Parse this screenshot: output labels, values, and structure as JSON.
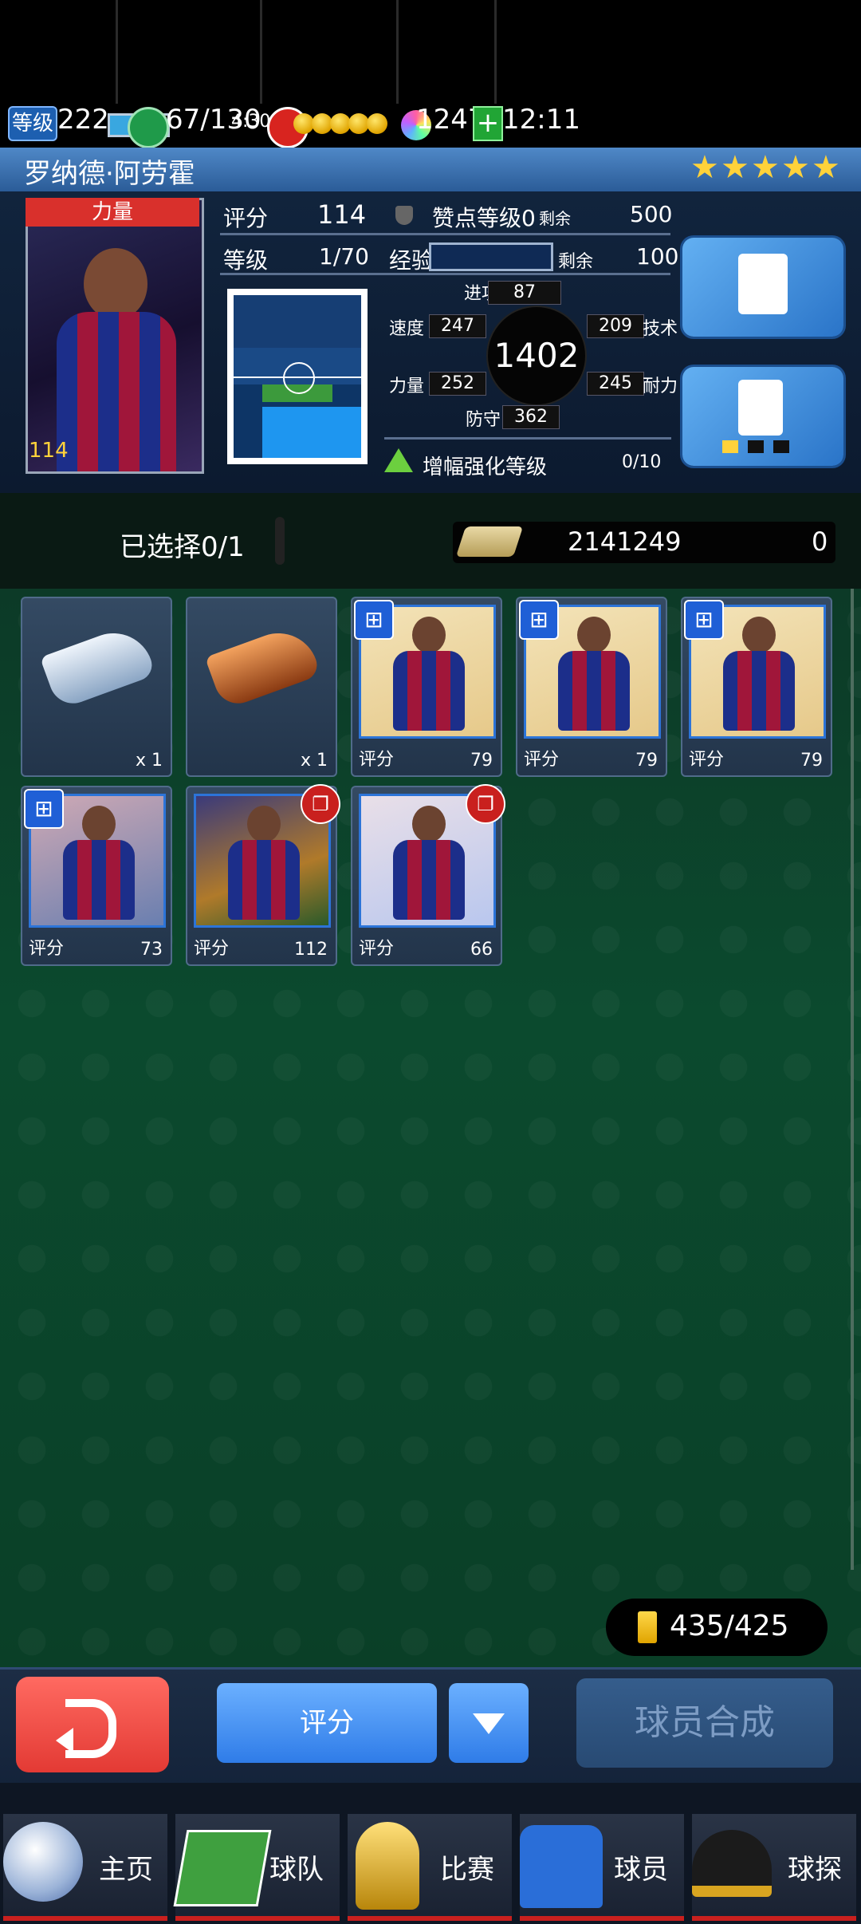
{
  "status": {
    "level_label": "等级",
    "level_value": "222",
    "level_xp_fraction": 0.45,
    "stamina": "67/130",
    "stamina_timer": "4:30",
    "gems": "1247",
    "clock": "12:11"
  },
  "player": {
    "name": "罗纳德·阿劳霍",
    "stars": 5,
    "card_tag": "力量",
    "card_rating": "114",
    "rating_label": "评分",
    "rating_value": "114",
    "sponsor_label": "赞点等级0",
    "sponsor_remaining_label": "剩余",
    "sponsor_value": "500",
    "level_label": "等级",
    "level_value": "1/70",
    "exp_label": "经验",
    "exp_remaining_label": "剩余",
    "exp_value": "100",
    "attack_label": "进攻",
    "attack_value": "87",
    "speed_label": "速度",
    "speed_value": "247",
    "technique_label": "技术",
    "technique_value": "209",
    "power_label": "力量",
    "power_value": "252",
    "stamina_label": "耐力",
    "stamina_value": "245",
    "defense_label": "防守",
    "defense_value": "362",
    "total": "1402",
    "enhance_label": "增幅强化等级",
    "enhance_value": "0/10"
  },
  "selection": {
    "selected_label": "已选择0/1",
    "coins": "2141249",
    "cost": "0"
  },
  "items": [
    {
      "type": "boot-silver",
      "qty": "x 1"
    },
    {
      "type": "boot-bronze",
      "qty": "x 1"
    },
    {
      "type": "player",
      "label": "评分",
      "value": "79",
      "badge": "grid"
    },
    {
      "type": "player",
      "label": "评分",
      "value": "79",
      "badge": "grid"
    },
    {
      "type": "player",
      "label": "评分",
      "value": "79",
      "badge": "grid"
    },
    {
      "type": "player",
      "label": "评分",
      "value": "73",
      "badge": "grid"
    },
    {
      "type": "player",
      "label": "评分",
      "value": "112",
      "badge": "copy"
    },
    {
      "type": "player",
      "label": "评分",
      "value": "66",
      "badge": "copy"
    }
  ],
  "inventory_count": "435/425",
  "actions": {
    "sort_label": "评分",
    "combine_label": "球员合成"
  },
  "nav": [
    {
      "label": "主页",
      "icon": "ball-icon"
    },
    {
      "label": "球队",
      "icon": "pitch-icon"
    },
    {
      "label": "比赛",
      "icon": "trophy-icon"
    },
    {
      "label": "球员",
      "icon": "jersey-icon"
    },
    {
      "label": "球探",
      "icon": "scout-cap-icon"
    }
  ],
  "colors": {
    "accent": "#2f7ce8",
    "danger": "#e33a34",
    "gold": "#ffd23a"
  }
}
